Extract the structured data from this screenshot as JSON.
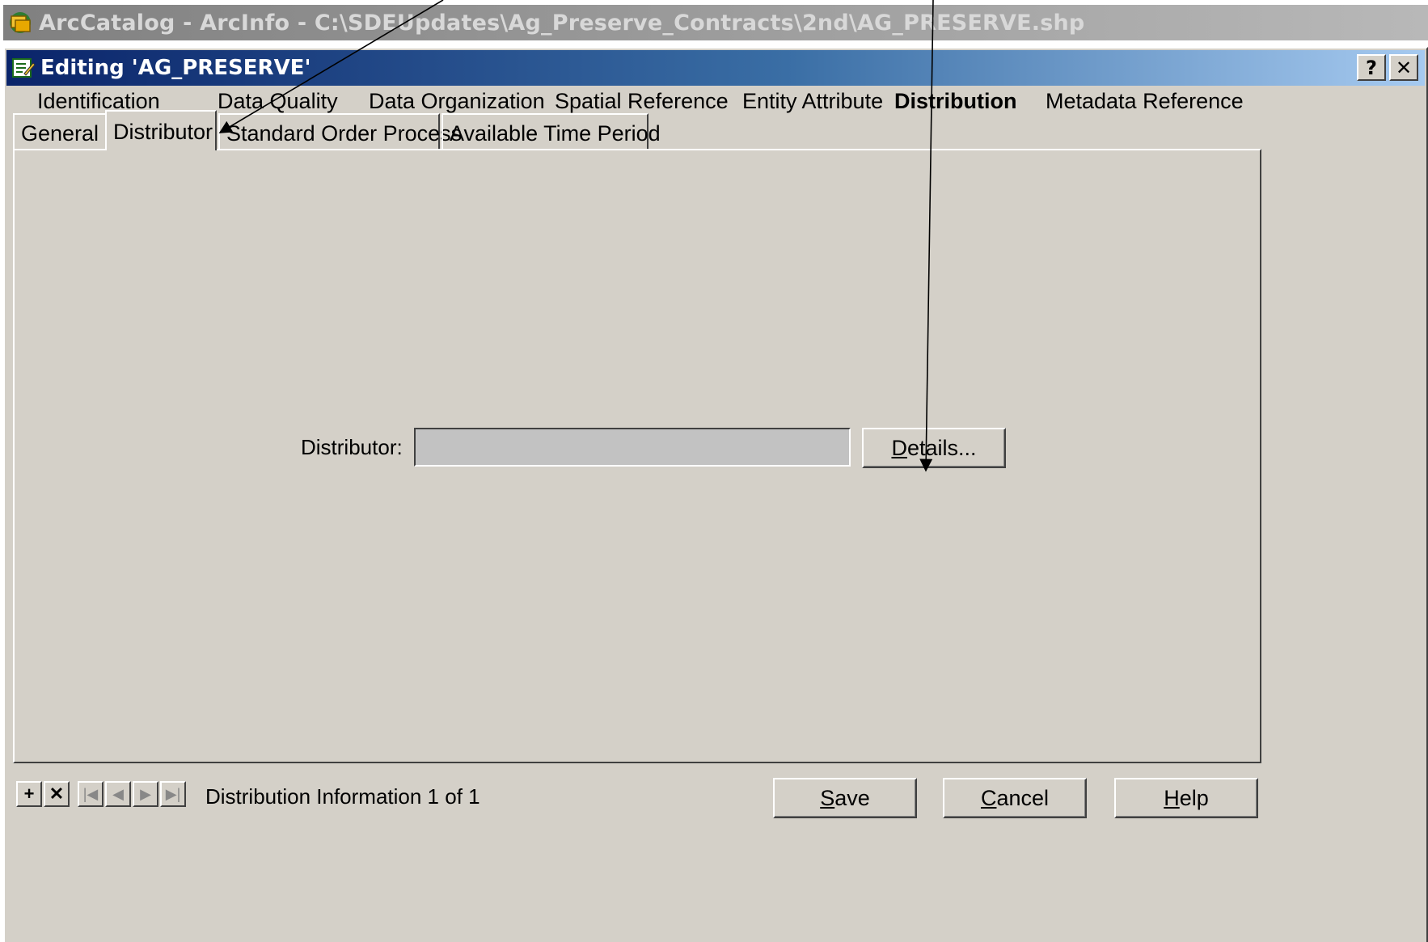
{
  "app_window": {
    "title": "ArcCatalog - ArcInfo - C:\\SDEUpdates\\Ag_Preserve_Contracts\\2nd\\AG_PRESERVE.shp"
  },
  "dialog": {
    "title": "Editing 'AG_PRESERVE'",
    "help_button": "?",
    "close_button": "✕"
  },
  "sections": [
    {
      "label": "Identification",
      "active": false
    },
    {
      "label": "Data Quality",
      "active": false
    },
    {
      "label": "Data Organization",
      "active": false
    },
    {
      "label": "Spatial Reference",
      "active": false
    },
    {
      "label": "Entity Attribute",
      "active": false
    },
    {
      "label": "Distribution",
      "active": true
    },
    {
      "label": "Metadata Reference",
      "active": false
    }
  ],
  "subtabs": [
    {
      "label": "General",
      "active": false
    },
    {
      "label": "Distributor",
      "active": true
    },
    {
      "label": "Standard Order Process",
      "active": false
    },
    {
      "label": "Available Time Period",
      "active": false
    }
  ],
  "form": {
    "distributor_label": "Distributor:",
    "distributor_value": "",
    "details_button": {
      "accel": "D",
      "rest": "etails..."
    }
  },
  "footer": {
    "nav_add": "+",
    "nav_delete": "✕",
    "nav_first": "|◀",
    "nav_prev": "◀",
    "nav_next": "▶",
    "nav_last": "▶|",
    "record_info": "Distribution Information 1 of 1",
    "save_button": {
      "accel": "S",
      "rest": "ave"
    },
    "cancel_button": {
      "accel": "C",
      "rest": "ancel"
    },
    "help_button": {
      "accel": "H",
      "rest": "elp"
    }
  }
}
